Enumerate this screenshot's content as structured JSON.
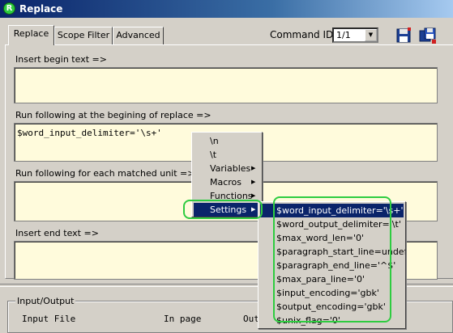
{
  "window": {
    "title": "Replace",
    "icon": "app-logo-icon"
  },
  "tabs": [
    {
      "label": "Replace"
    },
    {
      "label": "Scope Filter"
    },
    {
      "label": "Advanced"
    }
  ],
  "command": {
    "label": "Command ID =>",
    "value": "1/1"
  },
  "toolbar": {
    "icons": [
      "save-icon",
      "save-all-icon"
    ]
  },
  "sections": {
    "begin_label": "Insert begin text =>",
    "begin_value": "",
    "run_begin_label": "Run following at the begining of replace =>",
    "run_begin_value": "$word_input_delimiter='\\s+'",
    "run_each_label": "Run following for each matched unit =>",
    "run_each_value": "",
    "end_label": "Insert end text =>",
    "end_value": ""
  },
  "context_menu": {
    "items": [
      "\\n",
      "\\t",
      "Variables",
      "Macros",
      "Functions",
      "Settings"
    ],
    "selected": "Settings"
  },
  "settings_submenu": {
    "items": [
      "$word_input_delimiter='\\s+'",
      "$word_output_delimiter='\\t'",
      "$max_word_len='0'",
      "$paragraph_start_line=undef",
      "$paragraph_end_line='^$'",
      "$max_para_line='0'",
      "$input_encoding='gbk'",
      "$output_encoding='gbk'",
      "$unix_flag='0'"
    ]
  },
  "io": {
    "group_label": "Input/Output",
    "columns": [
      "Input File",
      "In page",
      "Out"
    ]
  },
  "colors": {
    "field_bg": "#fffbdc",
    "highlight": "#0a246a",
    "annotation_ring": "#2ecc40"
  }
}
